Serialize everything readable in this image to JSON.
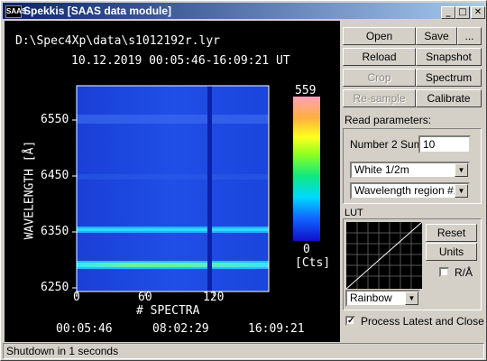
{
  "window": {
    "title": "Spekkis [SAAS data module]",
    "app_icon": "SAAS",
    "min_label": "_",
    "max_label": "□",
    "close_label": "✕"
  },
  "plot": {
    "file_path": "D:\\Spec4Xp\\data\\s1012192r.lyr",
    "time_range": "10.12.2019 00:05:46-16:09:21 UT",
    "ylabel": "WAVELENGTH [Å]",
    "xlabel": "# SPECTRA",
    "y_ticks": [
      "6550",
      "6450",
      "6350",
      "6250"
    ],
    "x_ticks": [
      "0",
      "60",
      "120"
    ],
    "time_ticks": [
      "00:05:46",
      "08:02:29",
      "16:09:21"
    ],
    "colorbar_max": "559",
    "colorbar_min": "0",
    "colorbar_unit": "[Cts]"
  },
  "buttons": {
    "open": "Open",
    "save": "Save",
    "more": "...",
    "reload": "Reload",
    "snapshot": "Snapshot",
    "crop": "Crop",
    "spectrum": "Spectrum",
    "resample": "Re-sample",
    "calibrate": "Calibrate"
  },
  "read_params": {
    "heading": "Read parameters:",
    "number_label": "Number 2 Sum",
    "number_value": "10",
    "filter_value": "White 1/2m",
    "region_value": "Wavelength region #1"
  },
  "lut": {
    "heading": "LUT",
    "reset": "Reset",
    "units": "Units",
    "ra_label": "R/Å",
    "ra_checked": false,
    "colormap": "Rainbow"
  },
  "process_latest": {
    "label": "Process Latest and Close",
    "checked": true
  },
  "status": "Shutdown in 1 seconds"
}
